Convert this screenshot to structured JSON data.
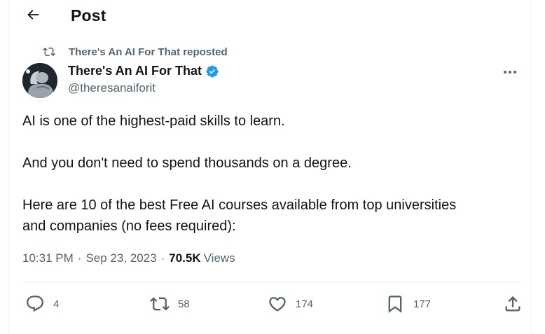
{
  "header": {
    "title": "Post"
  },
  "repost": {
    "text": "There's An AI For That reposted"
  },
  "author": {
    "name": "There's An AI For That",
    "handle": "@theresanaiforit"
  },
  "tweet": {
    "lines": [
      "AI is one of the highest-paid skills to learn.",
      "And you don't need to spend thousands on a degree.",
      "Here are 10 of the best Free AI courses available from top universities",
      "and companies (no fees required):"
    ]
  },
  "meta": {
    "time": "10:31 PM",
    "separator": "·",
    "date": "Sep 23, 2023",
    "views_count": "70.5K",
    "views_label": "Views"
  },
  "actions": {
    "replies": "4",
    "reposts": "58",
    "likes": "174",
    "bookmarks": "177"
  },
  "icons": {
    "back": "arrow-left-icon",
    "repost": "repost-icon",
    "verified": "verified-badge-icon",
    "more": "more-dots-icon",
    "reply": "reply-icon",
    "like": "heart-icon",
    "bookmark": "bookmark-icon",
    "share": "share-icon"
  },
  "colors": {
    "text": "#0f1419",
    "secondary": "#536471",
    "verified": "#1d9bf0",
    "divider": "#eff3f4"
  }
}
